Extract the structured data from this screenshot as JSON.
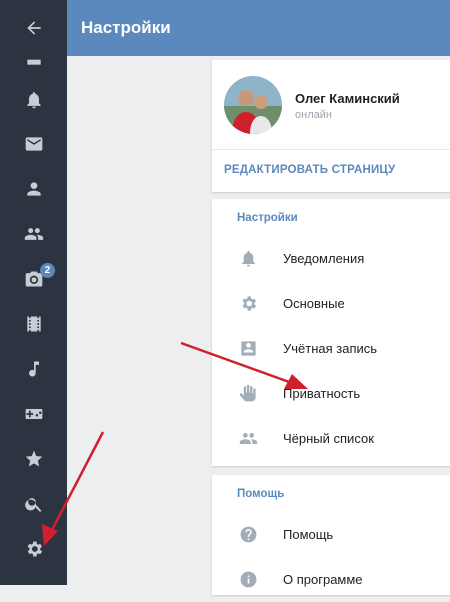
{
  "header": {
    "title": "Настройки"
  },
  "sidebar": {
    "items": [
      {
        "icon": "back-arrow-icon"
      },
      {
        "icon": "news-icon"
      },
      {
        "icon": "bell-icon"
      },
      {
        "icon": "mail-icon"
      },
      {
        "icon": "person-icon"
      },
      {
        "icon": "friends-icon"
      },
      {
        "icon": "camera-icon",
        "badge": "2"
      },
      {
        "icon": "film-icon"
      },
      {
        "icon": "music-icon"
      },
      {
        "icon": "gamepad-icon"
      },
      {
        "icon": "star-icon"
      },
      {
        "icon": "search-icon"
      },
      {
        "icon": "gear-icon"
      }
    ]
  },
  "profile": {
    "name": "Олег Каминский",
    "status": "онлайн",
    "edit_label": "РЕДАКТИРОВАТЬ СТРАНИЦУ"
  },
  "settings_section": {
    "title": "Настройки",
    "items": [
      {
        "label": "Уведомления",
        "icon": "bell-icon"
      },
      {
        "label": "Основные",
        "icon": "gear-icon"
      },
      {
        "label": "Учётная запись",
        "icon": "account-card-icon"
      },
      {
        "label": "Приватность",
        "icon": "hand-icon"
      },
      {
        "label": "Чёрный список",
        "icon": "blocked-people-icon"
      }
    ]
  },
  "help_section": {
    "title": "Помощь",
    "items": [
      {
        "label": "Помощь",
        "icon": "question-icon"
      },
      {
        "label": "О программе",
        "icon": "info-icon"
      }
    ]
  },
  "colors": {
    "header": "#5b88bd",
    "sidebar": "#2b3440",
    "accent": "#5b88bd",
    "annotation_arrow": "#d0202e"
  }
}
